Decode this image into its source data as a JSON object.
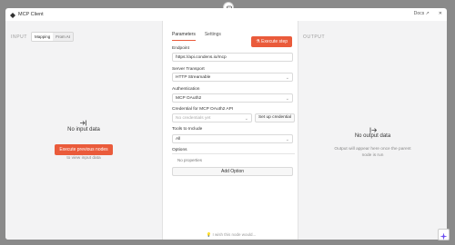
{
  "header": {
    "title": "MCP Client",
    "docs_label": "Docs",
    "close_label": "✕"
  },
  "left": {
    "pane_label": "INPUT",
    "toggle": [
      "Mapping",
      "From AI"
    ],
    "empty_title": "No input data",
    "execute_prev_label": "Execute previous nodes",
    "hint": "to view input data",
    "icon": "input-arrow-icon"
  },
  "middle": {
    "tabs": [
      "Parameters",
      "Settings"
    ],
    "execute_step_label": "Execute step",
    "endpoint": {
      "label": "Endpoint",
      "value": "https://api.condens.io/mcp"
    },
    "transport": {
      "label": "Server Transport",
      "value": "HTTP Streamable"
    },
    "auth": {
      "label": "Authentication",
      "value": "MCP OAuth2"
    },
    "credential": {
      "label": "Credential for MCP OAuth2 API",
      "placeholder": "No credentials yet",
      "setup_label": "Set up credential"
    },
    "tools": {
      "label": "Tools to Include",
      "value": "All"
    },
    "options": {
      "label": "Options",
      "empty": "No properties",
      "add_label": "Add Option"
    },
    "feedback": "I wish this node would..."
  },
  "right": {
    "pane_label": "OUTPUT",
    "empty_title": "No output data",
    "hint": "Output will appear here once the parent node is run",
    "icon": "output-arrow-icon"
  },
  "colors": {
    "accent": "#ea5b3b"
  }
}
